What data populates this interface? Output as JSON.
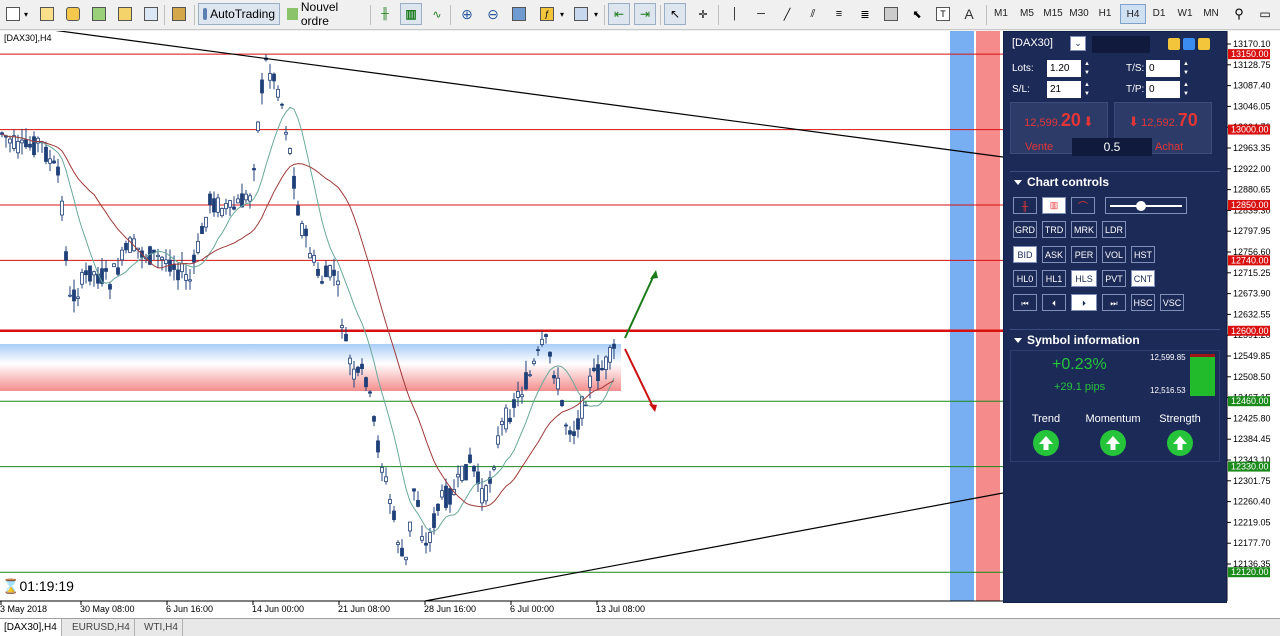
{
  "toolbar": {
    "autotrading_label": "AutoTrading",
    "new_order_label": "Nouvel ordre",
    "text_tool_label": "A",
    "timeframes": [
      "M1",
      "M5",
      "M15",
      "M30",
      "H1",
      "H4",
      "D1",
      "W1",
      "MN"
    ],
    "active_timeframe": "H4"
  },
  "chart": {
    "symbol_title": "[DAX30],H4",
    "countdown": "01:19:19",
    "x_labels": [
      "3 May 2018",
      "30 May 08:00",
      "6 Jun 16:00",
      "14 Jun 00:00",
      "21 Jun 08:00",
      "28 Jun 16:00",
      "6 Jul 00:00",
      "13 Jul 08:00"
    ],
    "y_labels": [
      "13170.10",
      "13128.75",
      "13087.40",
      "13046.05",
      "13004.70",
      "12963.35",
      "12922.00",
      "12880.65",
      "12839.30",
      "12797.95",
      "12756.60",
      "12715.25",
      "12673.90",
      "12632.55",
      "12591.20",
      "12549.85",
      "12508.50",
      "12467.15",
      "12425.80",
      "12384.45",
      "12343.10",
      "12301.75",
      "12260.40",
      "12219.05",
      "12177.70",
      "12136.35"
    ],
    "level_tags": [
      {
        "text": "13150.00",
        "color": "#d81010"
      },
      {
        "text": "13000.00",
        "color": "#d81010"
      },
      {
        "text": "12850.00",
        "color": "#d81010"
      },
      {
        "text": "12740.00",
        "color": "#d81010"
      },
      {
        "text": "12600.00",
        "color": "#d81010"
      },
      {
        "text": "12460.00",
        "color": "#1a8a1a"
      },
      {
        "text": "12330.00",
        "color": "#1a8a1a"
      },
      {
        "text": "12120.00",
        "color": "#1a8a1a"
      }
    ]
  },
  "panel": {
    "symbol": "[DAX30]",
    "lots_label": "Lots:",
    "lots_value": "1.20",
    "ts_label": "T/S:",
    "ts_value": "0",
    "sl_label": "S/L:",
    "sl_value": "21",
    "tp_label": "T/P:",
    "tp_value": "0",
    "sell_price_small": "12,599.",
    "sell_price_big": "20",
    "sell_label": "Vente",
    "buy_price_small": "12,592.",
    "buy_price_big": "70",
    "buy_label": "Achat",
    "spread_value": "0.5",
    "chart_controls_title": "Chart controls",
    "buttons_row1": [
      "GRD",
      "TRD",
      "MRK",
      "LDR"
    ],
    "buttons_row2": [
      "BID",
      "ASK",
      "PER",
      "VOL",
      "HST"
    ],
    "buttons_row3": [
      "HL0",
      "HL1",
      "HLS",
      "PVT",
      "CNT"
    ],
    "nav_hsc": "HSC",
    "nav_vsc": "VSC",
    "symbol_info_title": "Symbol information",
    "change_percent": "+0.23%",
    "change_pips": "+29.1 pips",
    "high_value": "12,599.85",
    "low_value": "12,516.53",
    "trend_label": "Trend",
    "momentum_label": "Momentum",
    "strength_label": "Strength",
    "colors": {
      "up": "#25c43a",
      "down": "#e23636",
      "panel": "#1c2a57"
    }
  },
  "tabs": [
    "[DAX30],H4",
    "EURUSD,H4",
    "WTI,H4"
  ]
}
